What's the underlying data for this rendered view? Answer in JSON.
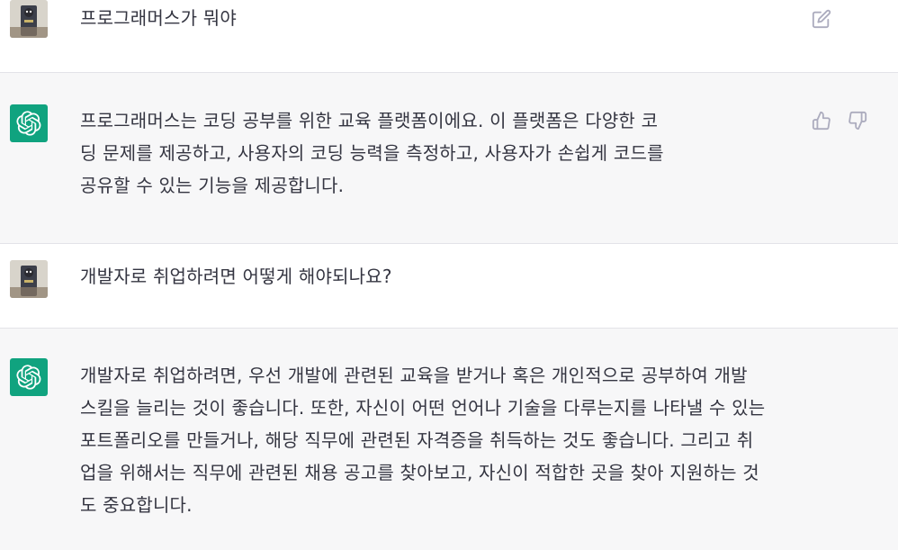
{
  "conversation": [
    {
      "role": "user",
      "lines": [
        "프로그래머스가 뭐야"
      ]
    },
    {
      "role": "assistant",
      "lines": [
        "프로그래머스는 코딩 공부를 위한 교육 플랫폼이에요. 이 플랫폼은 다양한 코",
        "딩 문제를 제공하고, 사용자의 코딩 능력을 측정하고, 사용자가 손쉽게 코드를",
        "공유할 수 있는 기능을 제공합니다."
      ]
    },
    {
      "role": "user",
      "lines": [
        "개발자로 취업하려면 어떻게 해야되나요?"
      ]
    },
    {
      "role": "assistant",
      "lines": [
        "개발자로 취업하려면, 우선 개발에 관련된 교육을 받거나 혹은 개인적으로 공부하여 개발",
        "스킬을 늘리는 것이 좋습니다. 또한, 자신이 어떤 언어나 기술을 다루는지를 나타낼 수 있는",
        "포트폴리오를 만들거나, 해당 직무에 관련된 자격증을 취득하는 것도 좋습니다. 그리고 취",
        "업을 위해서는 직무에 관련된 채용 공고를 찾아보고, 자신이 적합한 곳을 찾아 지원하는 것",
        "도 중요합니다."
      ]
    }
  ],
  "icons": {
    "edit": "edit-icon",
    "thumbs_up": "thumbs-up-icon",
    "thumbs_down": "thumbs-down-icon",
    "assistant_logo": "openai-logo-icon"
  },
  "colors": {
    "assistant_bg": "#f7f7f8",
    "user_bg": "#ffffff",
    "logo_green": "#10a37f",
    "text": "#343541",
    "icon": "#acacbe"
  }
}
